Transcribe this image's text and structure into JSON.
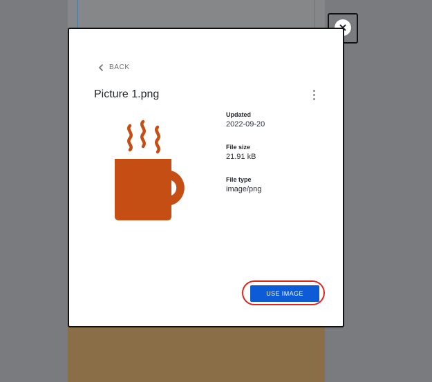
{
  "overlay": {
    "close_icon": "close-icon"
  },
  "modal": {
    "back_label": "BACK",
    "back_icon": "chevron-left-icon",
    "title": "Picture 1.png",
    "menu_icon": "more-vertical-icon",
    "preview_icon": "coffee-mug-icon",
    "preview_color": "#C44E14",
    "metadata": [
      {
        "label": "Updated",
        "value": "2022-09-20"
      },
      {
        "label": "File size",
        "value": "21.91 kB"
      },
      {
        "label": "File type",
        "value": "image/png"
      }
    ],
    "use_button_label": "USE IMAGE",
    "use_button_color": "#0D5BD6",
    "highlight_color": "#E0231D"
  }
}
